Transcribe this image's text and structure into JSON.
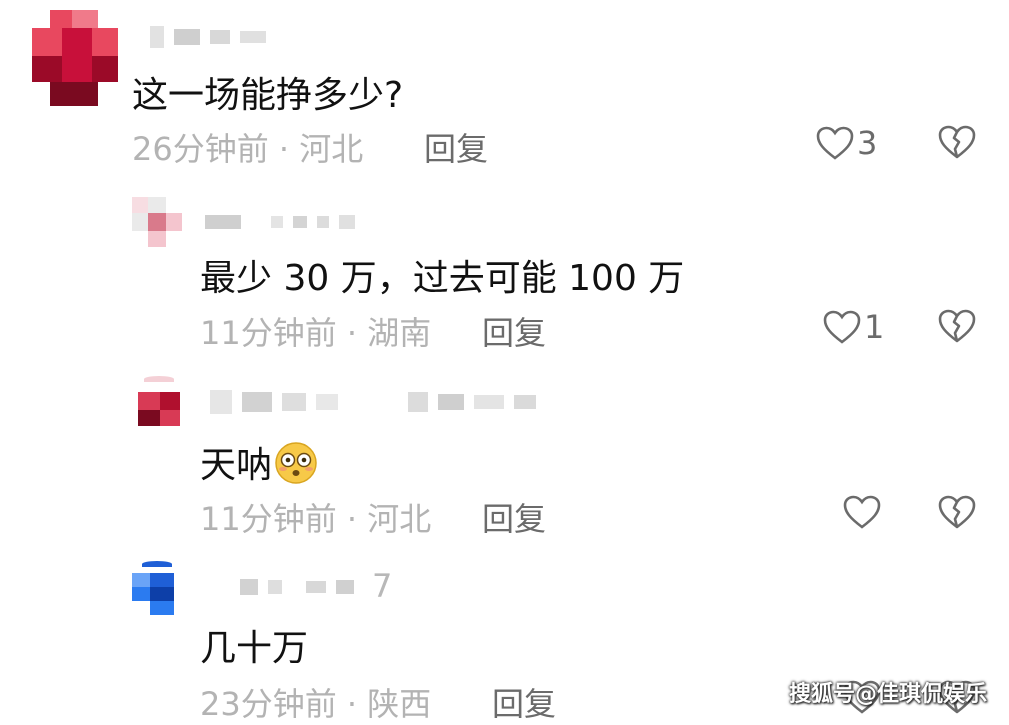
{
  "comments": [
    {
      "text": "这一场能挣多少?",
      "meta": "26分钟前 · 河北",
      "reply_label": "回复",
      "like_count": "3",
      "avatar_colors": [
        "#c8103a",
        "#e8485f",
        "#9b0a28",
        "#f07a8a"
      ]
    },
    {
      "text": "最少 30 万，过去可能 100 万",
      "meta": "11分钟前 · 湖南",
      "reply_label": "回复",
      "like_count": "1",
      "avatar_colors": [
        "#f4c5ce",
        "#d97a8b",
        "#eaeaea",
        "#f7dde2"
      ]
    },
    {
      "text": "天呐",
      "emoji": "flushed-face-icon",
      "meta": "11分钟前 · 河北",
      "reply_label": "回复",
      "like_count": "",
      "avatar_colors": [
        "#b0102e",
        "#d83a55",
        "#7a0a20",
        "#ffffff"
      ]
    },
    {
      "text": "几十万",
      "meta": "23分钟前 · 陕西",
      "reply_label": "回复",
      "like_count": "",
      "name_suffix": "7",
      "avatar_colors": [
        "#1f5fd6",
        "#2b7bf0",
        "#0d3fa8",
        "#6aa4f7"
      ]
    }
  ],
  "watermark": "搜狐号@佳琪侃娱乐",
  "colors": {
    "text": "#111111",
    "meta": "#b3b3b3",
    "icon": "#6b6b6b"
  }
}
